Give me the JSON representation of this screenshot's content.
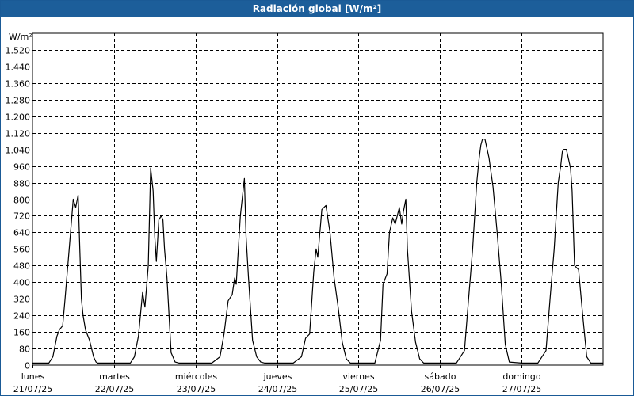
{
  "window": {
    "title": "Radiación global [W/m²]"
  },
  "colors": {
    "titlebar": "#1c5e9a",
    "line": "#000000",
    "grid": "#000000"
  },
  "chart_data": {
    "type": "line",
    "title": "Radiación global [W/m²]",
    "ylabel": "W/m²",
    "ylim": [
      0,
      1600
    ],
    "xlim": [
      0,
      7
    ],
    "grid": true,
    "yticks": [
      0,
      80,
      160,
      240,
      320,
      400,
      480,
      560,
      640,
      720,
      800,
      880,
      960,
      1040,
      1120,
      1200,
      1280,
      1360,
      1440,
      1520
    ],
    "ytick_labels": [
      "0",
      "80",
      "160",
      "240",
      "320",
      "400",
      "480",
      "560",
      "640",
      "720",
      "800",
      "880",
      "960",
      "1.040",
      "1.120",
      "1.200",
      "1.280",
      "1.360",
      "1.440",
      "1.520"
    ],
    "day_ticks": [
      {
        "day": "lunes",
        "date": "21/07/25"
      },
      {
        "day": "martes",
        "date": "22/07/25"
      },
      {
        "day": "miércoles",
        "date": "23/07/25"
      },
      {
        "day": "jueves",
        "date": "24/07/25"
      },
      {
        "day": "viernes",
        "date": "25/07/25"
      },
      {
        "day": "sábado",
        "date": "26/07/25"
      },
      {
        "day": "domingo",
        "date": "27/07/25"
      }
    ],
    "series": [
      {
        "x": [
          0.0,
          0.2,
          0.25,
          0.3,
          0.33,
          0.37,
          0.4,
          0.45,
          0.5,
          0.53,
          0.56,
          0.58,
          0.6,
          0.62,
          0.65,
          0.7,
          0.75,
          0.78,
          0.8,
          0.85,
          0.9,
          1.0,
          1.2,
          1.25,
          1.3,
          1.35,
          1.38,
          1.42,
          1.45,
          1.48,
          1.5,
          1.52,
          1.55,
          1.58,
          1.6,
          1.62,
          1.65,
          1.7,
          1.75,
          1.8,
          1.85,
          2.0,
          2.2,
          2.3,
          2.35,
          2.4,
          2.45,
          2.48,
          2.5,
          2.55,
          2.6,
          2.62,
          2.65,
          2.7,
          2.75,
          2.8,
          2.85,
          3.0,
          3.2,
          3.3,
          3.35,
          3.4,
          3.45,
          3.48,
          3.5,
          3.55,
          3.6,
          3.65,
          3.7,
          3.75,
          3.8,
          3.85,
          3.9,
          4.0,
          4.2,
          4.27,
          4.3,
          4.35,
          4.38,
          4.42,
          4.45,
          4.5,
          4.53,
          4.55,
          4.58,
          4.6,
          4.65,
          4.7,
          4.75,
          4.8,
          4.85,
          5.0,
          5.2,
          5.3,
          5.35,
          5.4,
          5.45,
          5.48,
          5.5,
          5.52,
          5.55,
          5.6,
          5.65,
          5.7,
          5.75,
          5.8,
          5.85,
          6.0,
          6.2,
          6.3,
          6.35,
          6.4,
          6.45,
          6.48,
          6.5,
          6.52,
          6.55,
          6.6,
          6.62,
          6.65,
          6.7,
          6.75,
          6.8,
          6.85,
          7.0
        ],
        "y": [
          10,
          10,
          40,
          140,
          170,
          190,
          320,
          560,
          800,
          760,
          820,
          560,
          320,
          240,
          170,
          120,
          40,
          15,
          10,
          10,
          10,
          10,
          10,
          40,
          140,
          350,
          280,
          480,
          950,
          840,
          620,
          500,
          700,
          720,
          700,
          560,
          420,
          60,
          15,
          10,
          10,
          10,
          10,
          40,
          150,
          310,
          340,
          420,
          390,
          720,
          900,
          620,
          420,
          120,
          40,
          15,
          10,
          10,
          10,
          40,
          130,
          150,
          450,
          560,
          520,
          750,
          770,
          640,
          420,
          280,
          110,
          30,
          10,
          10,
          10,
          120,
          390,
          440,
          640,
          710,
          680,
          760,
          680,
          740,
          800,
          560,
          260,
          110,
          30,
          10,
          10,
          10,
          10,
          70,
          320,
          560,
          880,
          1000,
          1060,
          1090,
          1090,
          1000,
          860,
          640,
          400,
          100,
          15,
          10,
          10,
          70,
          320,
          560,
          880,
          960,
          1030,
          1040,
          1040,
          950,
          840,
          480,
          460,
          240,
          40,
          10,
          10
        ]
      }
    ]
  }
}
